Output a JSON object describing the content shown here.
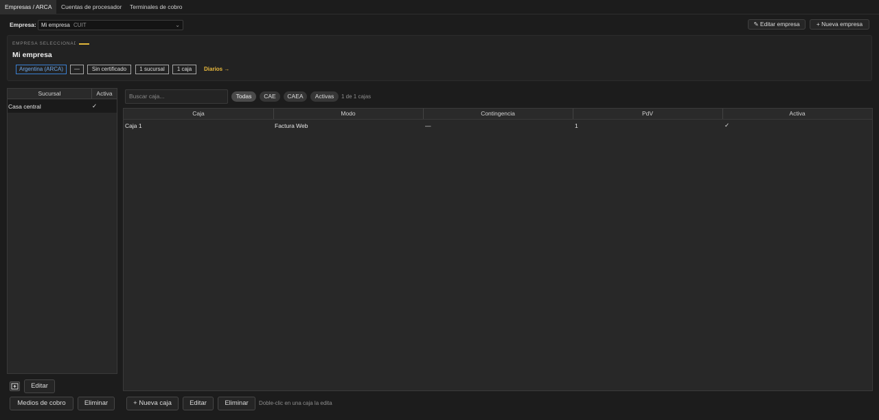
{
  "tabs": [
    {
      "label": "Empresas / ARCA",
      "active": true
    },
    {
      "label": "Cuentas de procesador",
      "active": false
    },
    {
      "label": "Terminales de cobro",
      "active": false
    }
  ],
  "company_selector": {
    "label": "Empresa:",
    "value": "Mi empresa",
    "cuit": "CUIT"
  },
  "toolbar": {
    "edit_label": "✎ Editar empresa",
    "new_label": "+ Nueva empresa"
  },
  "selected_company": {
    "section_label": "EMPRESA SELECCIONADA",
    "name": "Mi empresa",
    "chips": [
      "Argentina (ARCA)",
      "—",
      "Sin certificado",
      "1 sucursal",
      "1 caja"
    ],
    "diarios_link": "Diarios →"
  },
  "sucursal_table": {
    "columns": [
      "Sucursal",
      "Activa"
    ],
    "rows": [
      {
        "sucursal": "Casa central",
        "activa": "✓"
      }
    ]
  },
  "filters": {
    "search_placeholder": "Buscar caja...",
    "pills": [
      "Todas",
      "CAE",
      "CAEA",
      "Activas"
    ],
    "selected_pill": "Todas",
    "count_text": "1 de 1 cajas"
  },
  "caja_table": {
    "columns": [
      "Caja",
      "Modo",
      "Contingencia",
      "PdV",
      "Activa"
    ],
    "rows": [
      {
        "caja": "Caja 1",
        "modo": "Factura Web",
        "contingencia": "—",
        "pdv": "1",
        "activa": "✓"
      }
    ]
  },
  "sucursal_actions": {
    "edit": "Editar",
    "payment_methods": "Medios de cobro",
    "delete": "Eliminar"
  },
  "caja_actions": {
    "new": "+ Nueva caja",
    "edit": "Editar",
    "delete": "Eliminar",
    "hint": "Doble-clic en una caja la edita"
  },
  "colors": {
    "accent_yellow": "#e3b83b",
    "chip_blue": "#3b82d6",
    "background": "#1c1c1c"
  }
}
